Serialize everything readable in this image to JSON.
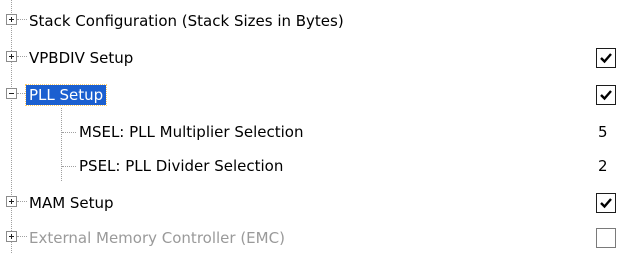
{
  "tree": {
    "items": [
      {
        "label": "Stack Configuration (Stack Sizes in Bytes)",
        "expander": "plus",
        "value_type": "none",
        "disabled": false,
        "selected": false
      },
      {
        "label": "VPBDIV Setup",
        "expander": "plus",
        "value_type": "checkbox",
        "checked": true,
        "disabled": false,
        "selected": false
      },
      {
        "label": "PLL Setup",
        "expander": "minus",
        "value_type": "checkbox",
        "checked": true,
        "disabled": false,
        "selected": true
      },
      {
        "label": "MSEL: PLL Multiplier Selection",
        "value_type": "text",
        "value": "5"
      },
      {
        "label": "PSEL: PLL Divider Selection",
        "value_type": "text",
        "value": "2"
      },
      {
        "label": "MAM Setup",
        "expander": "plus",
        "value_type": "checkbox",
        "checked": true,
        "disabled": false,
        "selected": false
      },
      {
        "label": "External Memory Controller (EMC)",
        "expander": "plus",
        "value_type": "checkbox",
        "checked": false,
        "disabled": true,
        "selected": false
      }
    ]
  },
  "colors": {
    "selection": "#1b5fd0",
    "disabled_text": "#9a9a9a",
    "tree_lines": "#a0a0a0"
  },
  "icons": {
    "expand": "plus-box-icon",
    "collapse": "minus-box-icon",
    "check": "checkmark-icon"
  }
}
